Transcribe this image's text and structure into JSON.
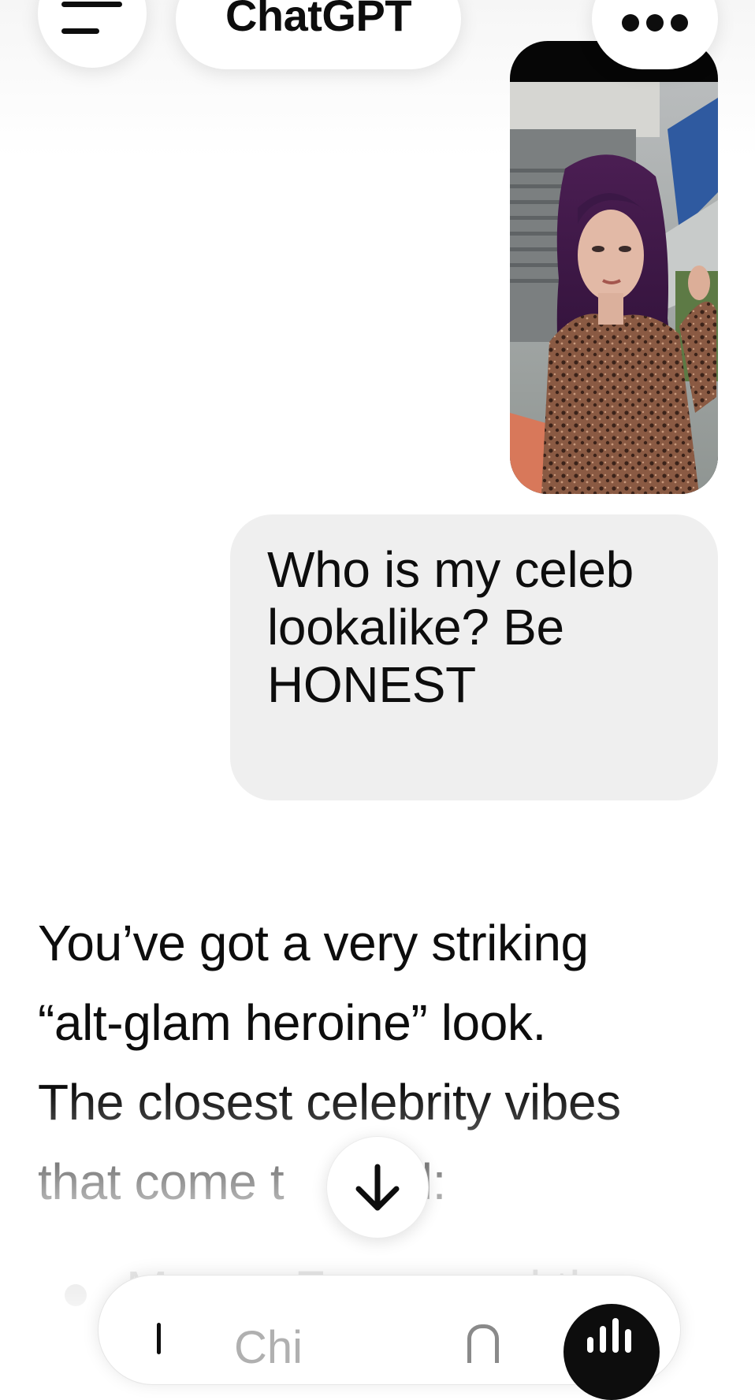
{
  "header": {
    "title": "ChatGPT",
    "menu_icon": "hamburger-menu-icon",
    "more_icon": "more-options-icon"
  },
  "conversation": {
    "user_photo": {
      "description_icon": "photo-attachment"
    },
    "user_message": {
      "line1": "Who is my celeb",
      "line2": "lookalike? Be",
      "line3": "HONEST"
    },
    "assistant_message": {
      "line1": "You’ve got a very striking",
      "line2": "“alt-glam heroine” look.",
      "line3": "The closest celebrity vibes",
      "line4a": "that come t",
      "line4b": "nd:",
      "bullet_partial": "Megan Fox … and the"
    }
  },
  "scroll_button": {
    "icon": "arrow-down-icon"
  },
  "composer": {
    "placeholder": "Chi",
    "plus_icon": "plus-icon",
    "mic_icon": "microphone-icon",
    "voice_icon": "voice-mode-icon"
  },
  "colors": {
    "text": "#0d0d0d",
    "bubble": "#efefef",
    "background": "#ffffff",
    "placeholder": "#b0b0b0"
  }
}
